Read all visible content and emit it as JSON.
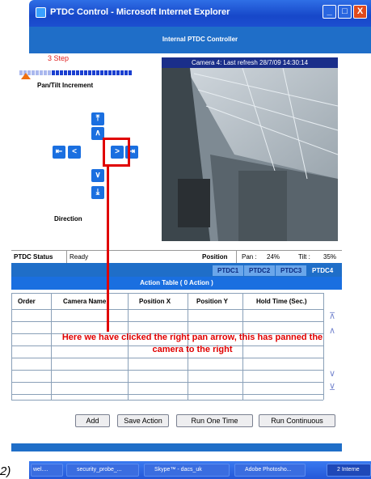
{
  "window": {
    "title": "PTDC Control - Microsoft Internet Explorer",
    "buttons": {
      "minimize": "_",
      "maximize": "□",
      "close": "X"
    }
  },
  "header": {
    "title": "Internal PTDC Controller"
  },
  "left_panel": {
    "step_label": "3 Step",
    "step_level": 0.3,
    "pan_tilt_label": "Pan/Tilt Increment",
    "direction_label": "Direction"
  },
  "camera": {
    "caption": "Camera 4: Last refresh 28/7/09 14:30:14"
  },
  "status": {
    "label": "PTDC Status",
    "value": "Ready",
    "position_label": "Position",
    "pan_label": "Pan :",
    "pan_value": "24%",
    "tilt_label": "Tilt :",
    "tilt_value": "35%"
  },
  "tabs": [
    "PTDC1",
    "PTDC2",
    "PTDC3",
    "PTDC4"
  ],
  "action_table": {
    "title": "Action Table  ( 0 Action )",
    "columns": [
      "Order",
      "Camera Name",
      "Position X",
      "Position Y",
      "Hold Time (Sec.)"
    ]
  },
  "buttons": [
    "Add",
    "Save Action",
    "Run One Time",
    "Run Continuous"
  ],
  "annotation": "Here we have clicked the right pan arrow, this has panned the camera to the right",
  "taskbar": [
    "wel....",
    "security_probe_...",
    "Skype™ - dacs_uk",
    "Adobe Photosho...",
    "2 Interne"
  ],
  "page_label": "2)"
}
